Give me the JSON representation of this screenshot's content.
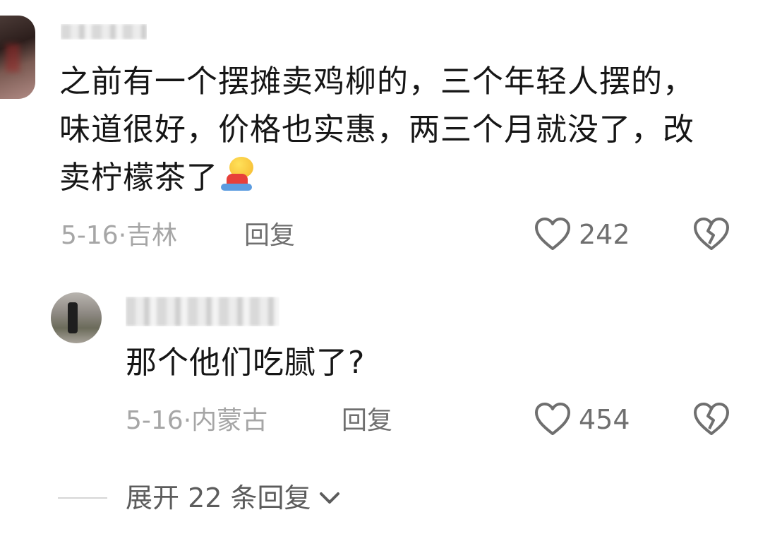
{
  "comment": {
    "text": "之前有一个摆摊卖鸡柳的，三个年轻人摆的，味道很好，价格也实惠，两三个月就没了，改卖柠檬茶了",
    "emoji": "kneeling-bow-emoji",
    "date_location": "5-16·吉林",
    "reply_label": "回复",
    "like_count": "242"
  },
  "reply": {
    "text": "那个他们吃腻了?",
    "date_location": "5-16·内蒙古",
    "reply_label": "回复",
    "like_count": "454"
  },
  "expand_replies": {
    "label": "展开 22 条回复"
  },
  "icons": {
    "like": "heart-outline-icon",
    "dislike": "broken-heart-icon",
    "expand": "chevron-down-icon"
  },
  "colors": {
    "text_primary": "#161616",
    "text_meta": "#a6a6a6",
    "text_secondary": "#6f6f6f",
    "icon": "#6f6f6f"
  }
}
